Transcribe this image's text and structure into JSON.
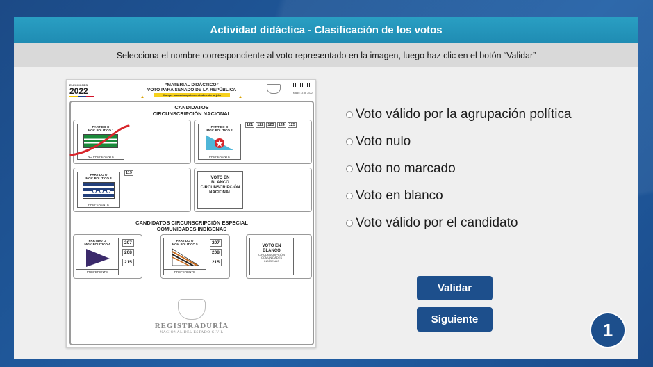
{
  "header": {
    "title": "Actividad didáctica - Clasificación de los votos",
    "instruction": "Selecciona el nombre correspondiente al voto representado en la imagen, luego haz clic en el botón “Validar”"
  },
  "ballot": {
    "logo_small": "ELECCIONES",
    "logo_year": "2022",
    "title_line1": "“MATERIAL DIDÁCTICO”",
    "title_line2": "VOTO PARA SENADO DE LA REPÚBLICA",
    "title_line3": "Marque una sola opción en toda esta tarjeta",
    "date_small": "Marzo 13 de 2022",
    "section1_line1": "CANDIDATOS",
    "section1_line2": "CIRCUNSCRIPCIÓN NACIONAL",
    "party1": {
      "line1": "PARTIDO O",
      "line2": "MOV. POLÍTICO 1",
      "pref": "NO PREFERENTE"
    },
    "party2": {
      "line1": "PARTIDO O",
      "line2": "MOV. POLÍTICO 2",
      "pref": "PREFERENTE",
      "numbers": [
        "121",
        "122",
        "123",
        "124",
        "125"
      ]
    },
    "party3": {
      "line1": "PARTIDO O",
      "line2": "MOV. POLÍTICO 3",
      "pref": "PREFERENTE",
      "numbers": [
        "119"
      ]
    },
    "blank_national": {
      "line1": "VOTO EN",
      "line2": "BLANCO",
      "line3": "CIRCUNSCRIPCIÓN",
      "line4": "NACIONAL"
    },
    "section2_line1": "CANDIDATOS CIRCUNSCRIPCIÓN ESPECIAL",
    "section2_line2": "COMUNIDADES INDÍGENAS",
    "party4": {
      "line1": "PARTIDO O",
      "line2": "MOV. POLÍTICO 4",
      "pref": "PREFERENTE",
      "numbers": [
        "207",
        "208",
        "215"
      ]
    },
    "party5": {
      "line1": "PARTIDO O",
      "line2": "MOV. POLÍTICO 5",
      "pref": "PREFERENTE",
      "numbers": [
        "207",
        "208",
        "215"
      ]
    },
    "blank_special": {
      "line1": "VOTO EN",
      "line2": "BLANCO",
      "line3": "CIRCUNSCRIPCIÓN",
      "line4": "COMUNIDADES",
      "line5": "INDÍGENAS"
    },
    "footer_line1": "REGISTRADURÍA",
    "footer_line2": "NACIONAL DEL ESTADO CIVIL"
  },
  "options": [
    {
      "label": "Voto válido por la agrupación política"
    },
    {
      "label": "Voto nulo"
    },
    {
      "label": "Voto no marcado"
    },
    {
      "label": "Voto en blanco"
    },
    {
      "label": "Voto válido por el candidato"
    }
  ],
  "buttons": {
    "validate": "Validar",
    "next": "Siguiente"
  },
  "page_number": "1",
  "colors": {
    "title_bar": "#1f8cb3",
    "button": "#1d4f8c",
    "background": "#1d4f8c"
  }
}
